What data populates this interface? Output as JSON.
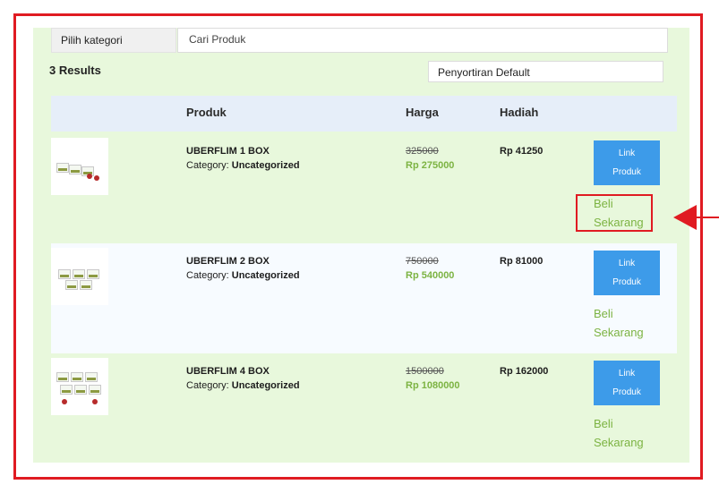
{
  "filter": {
    "category": "Pilih kategori",
    "search_placeholder": "Cari Produk"
  },
  "results": "3 Results",
  "sort": "Penyortiran Default",
  "columns": {
    "product": "Produk",
    "price": "Harga",
    "reward": "Hadiah"
  },
  "rows": [
    {
      "name": "UBERFLIM 1 BOX",
      "category_label": "Category:",
      "category": "Uncategorized",
      "old_price": "325000",
      "price": "Rp 275000",
      "reward": "Rp 41250",
      "button": [
        "Link",
        "Produk"
      ],
      "buy": [
        "Beli",
        "Sekarang"
      ]
    },
    {
      "name": "UBERFLIM 2 BOX",
      "category_label": "Category:",
      "category": "Uncategorized",
      "old_price": "750000",
      "price": "Rp 540000",
      "reward": "Rp 81000",
      "button": [
        "Link",
        "Produk"
      ],
      "buy": [
        "Beli",
        "Sekarang"
      ]
    },
    {
      "name": "UBERFLIM 4 BOX",
      "category_label": "Category:",
      "category": "Uncategorized",
      "old_price": "1500000",
      "price": "Rp 1080000",
      "reward": "Rp 162000",
      "button": [
        "Link",
        "Produk"
      ],
      "buy": [
        "Beli",
        "Sekarang"
      ]
    }
  ],
  "colors": {
    "annotation": "#e01b22",
    "panel": "#e8f8dc",
    "button": "#3d9be9",
    "green_text": "#7cb342"
  }
}
